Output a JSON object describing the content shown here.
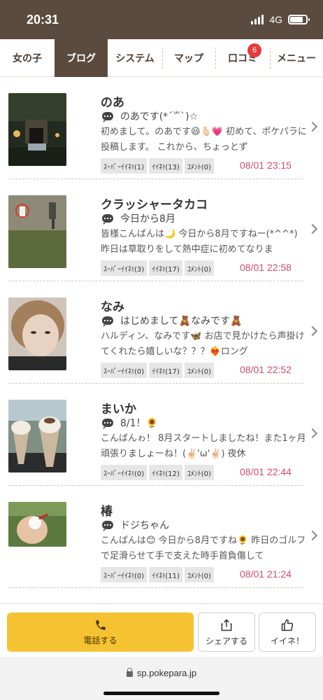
{
  "status": {
    "time": "20:31",
    "network": "4G"
  },
  "tabs": [
    {
      "label": "女の子",
      "active": false
    },
    {
      "label": "ブログ",
      "active": true
    },
    {
      "label": "システム",
      "active": false
    },
    {
      "label": "マップ",
      "active": false
    },
    {
      "label": "口コミ",
      "active": false,
      "badge": "6"
    },
    {
      "label": "メニュー",
      "active": false
    }
  ],
  "posts": [
    {
      "name": "のあ",
      "title": "のあです(*´꒳`)☆",
      "body": "初めまして。のあです😆🫰🏻💗 初めて、ポケパラに投稿します。 これから、ちょっとず",
      "stats": [
        "ｽｰﾊﾟｰｲｲﾈ!(1)",
        "ｲｲﾈ!(13)",
        "ｺﾒﾝﾄ(0)"
      ],
      "date": "08/01 23:15"
    },
    {
      "name": "クラッシャータカコ",
      "title": "今日から8月",
      "body": "皆様こんばんは🌙 今日から8月ですねー(*^^*) 昨日は草取りをして熱中症に初めてなりま",
      "stats": [
        "ｽｰﾊﾟｰｲｲﾈ!(3)",
        "ｲｲﾈ!(17)",
        "ｺﾒﾝﾄ(0)"
      ],
      "date": "08/01 22:58"
    },
    {
      "name": "なみ",
      "title": "はじめまして🧸なみです🧸",
      "body": "ハルディン、なみです🦋 お店で見かけたら声掛けてくれたら嬉しいな？？？❤️‍🔥ロング",
      "stats": [
        "ｽｰﾊﾟｰｲｲﾈ!(0)",
        "ｲｲﾈ!(17)",
        "ｺﾒﾝﾄ(0)"
      ],
      "date": "08/01 22:52"
    },
    {
      "name": "まいか",
      "title": "8/1！🌻",
      "body": "こんばんゎ！ 8月スタートしましたね！また1ヶ月頑張りましょーね！(✌🏻'ω'✌🏻) 夜休",
      "stats": [
        "ｽｰﾊﾟｰｲｲﾈ!(0)",
        "ｲｲﾈ!(12)",
        "ｺﾒﾝﾄ(0)"
      ],
      "date": "08/01 22:44"
    },
    {
      "name": "椿",
      "title": "ドジちゃん",
      "body": "こんばんは😊 今日から8月ですね🌻 昨日のゴルフで足滑らせて手で支えた時手首負傷して",
      "stats": [
        "ｽｰﾊﾟｰｲｲﾈ!(0)",
        "ｲｲﾈ!(11)",
        "ｺﾒﾝﾄ(0)"
      ],
      "date": "08/01 21:24"
    }
  ],
  "actions": {
    "call": "電話する",
    "share": "シェアする",
    "like": "イイネ！"
  },
  "url": "sp.pokepara.jp",
  "colors": {
    "header": "#5b4a3e",
    "call_button": "#f5c232",
    "date": "#d24b6d",
    "badge": "#e63b3b"
  }
}
